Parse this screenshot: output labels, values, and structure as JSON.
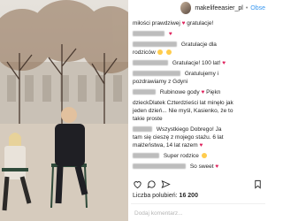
{
  "header": {
    "account": "makelifeeasier_pl",
    "follow": "Obse"
  },
  "comments": [
    {
      "tail": "miłości prawdziwej ",
      "end": "gratulacje!"
    },
    {
      "line1": "Gratulacje dla",
      "line2": "rodziców"
    },
    {
      "line1": "Gratulacje! 100 lat!"
    },
    {
      "line1": "Gratulujemy i",
      "line2": "pozdrawiamy z Gdyni"
    },
    {
      "line1": "Rubinowe gody",
      "line2": "Piękn"
    },
    {
      "line1": "dzieckDlatek Czterdzieści lat minęło jak",
      "line2": "jeden dzień... Nie myśl, Kasienko, że to",
      "line3": "takie proste"
    },
    {
      "line1": "Wszystkiego Dobrego! Ja",
      "line2": "tam się cieszę z mojego stażu. 6 lat",
      "line3": "małżeństwa, 14 lat razem"
    },
    {
      "line1": "Super rodzice"
    },
    {
      "line1": "So sweet"
    }
  ],
  "likes": {
    "label": "Liczba polubień: ",
    "count": "16 200"
  },
  "add_comment": "Dodaj komentarz..."
}
